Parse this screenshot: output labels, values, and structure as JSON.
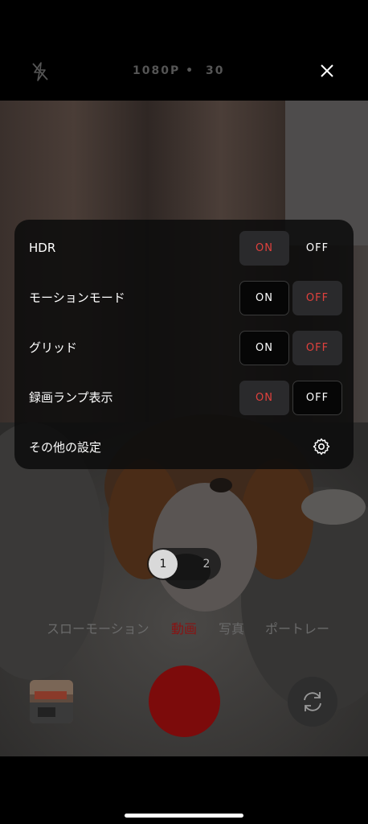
{
  "top_bar": {
    "flash_icon": "flash-off-icon",
    "resolution": "1080P •",
    "fps": "30",
    "close_icon": "close-icon"
  },
  "settings": {
    "rows": [
      {
        "label": "HDR",
        "on": "ON",
        "off": "OFF",
        "selected": "on"
      },
      {
        "label": "モーションモード",
        "on": "ON",
        "off": "OFF",
        "selected": "off"
      },
      {
        "label": "グリッド",
        "on": "ON",
        "off": "OFF",
        "selected": "off"
      },
      {
        "label": "録画ランプ表示",
        "on": "ON",
        "off": "OFF",
        "selected": "on"
      }
    ],
    "more": {
      "label": "その他の設定",
      "icon": "gear-icon"
    }
  },
  "zoom": {
    "options": [
      "1",
      "2"
    ],
    "selected": "1"
  },
  "modes": {
    "items": [
      "スローモーション",
      "動画",
      "写真",
      "ポートレー"
    ],
    "active": "動画"
  },
  "colors": {
    "accent_red": "#e0413d",
    "shutter_red": "#7c0b0b",
    "status_green": "#3ddc6a"
  }
}
